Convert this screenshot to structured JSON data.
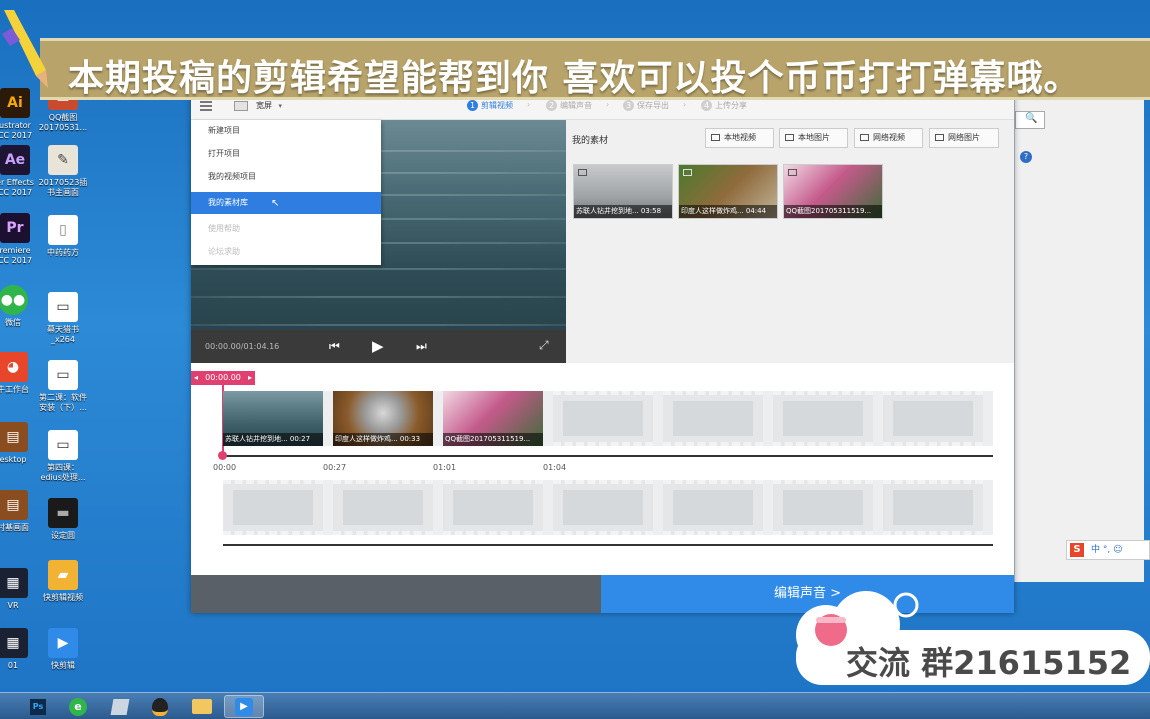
{
  "banner": {
    "text": "本期投稿的剪辑希望能帮到你 喜欢可以投个币币打打弹幕哦。"
  },
  "desktop": {
    "icons": [
      {
        "label": "ustrator\nCC 2017"
      },
      {
        "label": "er Effects\nCC 2017"
      },
      {
        "label": "remiere\nCC 2017"
      },
      {
        "label": "微信"
      },
      {
        "label": "牛工作台"
      },
      {
        "label": "esktop"
      },
      {
        "label": "村基画面"
      },
      {
        "label": "VR"
      },
      {
        "label": "01"
      }
    ],
    "icons_col2": [
      {
        "label": "QQ截图\n20170531..."
      },
      {
        "label": "20170523插\n书主画面"
      },
      {
        "label": "中药药方"
      },
      {
        "label": "幕天猎书\n_x264"
      },
      {
        "label": "第二课：软件\n安装（下）..."
      },
      {
        "label": "第四课：\nedius处理..."
      },
      {
        "label": "设定圆"
      },
      {
        "label": "快剪辑视频"
      },
      {
        "label": "快剪辑"
      }
    ],
    "ae_badge": "Ae",
    "pr_badge": "Pr"
  },
  "editor": {
    "aspect_label": "宽屏",
    "steps": [
      {
        "num": "1",
        "label": "剪辑视频"
      },
      {
        "num": "2",
        "label": "编辑声音"
      },
      {
        "num": "3",
        "label": "保存导出"
      },
      {
        "num": "4",
        "label": "上传分享"
      }
    ],
    "menu": [
      {
        "label": "新建项目"
      },
      {
        "label": "打开项目"
      },
      {
        "label": "我的视频项目"
      },
      {
        "label": "我的素材库"
      },
      {
        "label": "使用帮助"
      },
      {
        "label": "论坛求助"
      }
    ],
    "player_time": "00:00.00/01:04.16",
    "library": {
      "title": "我的素材",
      "buttons": [
        "本地视频",
        "本地图片",
        "网络视频",
        "网络图片"
      ],
      "items": [
        {
          "caption": "苏联人钻井挖到地... 03:58"
        },
        {
          "caption": "印度人这样做炸鸡... 04:44"
        },
        {
          "caption": "QQ截图201705311519..."
        }
      ]
    },
    "timeline": {
      "playhead": "00:00.00",
      "clips": [
        {
          "caption": "苏联人钻井挖到地... 00:27"
        },
        {
          "caption": "印度人这样做炸鸡... 00:33"
        },
        {
          "caption": "QQ截图201705311519..."
        }
      ],
      "ticks": [
        "00:00",
        "00:27",
        "01:01",
        "01:04"
      ]
    },
    "next_button": "编辑声音 >"
  },
  "group_ad": {
    "text": "交流 群21615152"
  },
  "ime": {
    "text": "中 °, ☺"
  }
}
